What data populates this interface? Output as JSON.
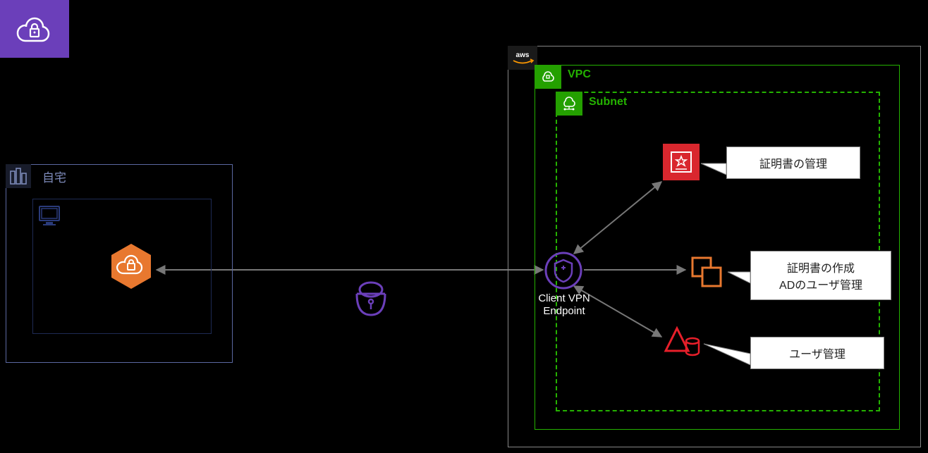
{
  "header": {
    "service_icon": "client-vpn"
  },
  "home": {
    "label": "自宅",
    "pc_icon": "computer",
    "vpn_client_icon": "aws-client-vpn-client"
  },
  "aws": {
    "logo": "aws",
    "vpc_label": "VPC",
    "subnet_label": "Subnet",
    "endpoint_label": "Client VPN\nEndpoint"
  },
  "callouts": {
    "cert": "証明書の管理",
    "cloud9": "証明書の作成\nADのユーザ管理",
    "ds": "ユーザ管理"
  },
  "icons": {
    "cert": "certificate-manager",
    "cloud9": "cloud9",
    "ds": "directory-service",
    "gateway": "vpn-gateway"
  },
  "colors": {
    "purple": "#6b3fba",
    "green": "#24b200",
    "orange": "#e8782f",
    "red": "#d9272e"
  }
}
